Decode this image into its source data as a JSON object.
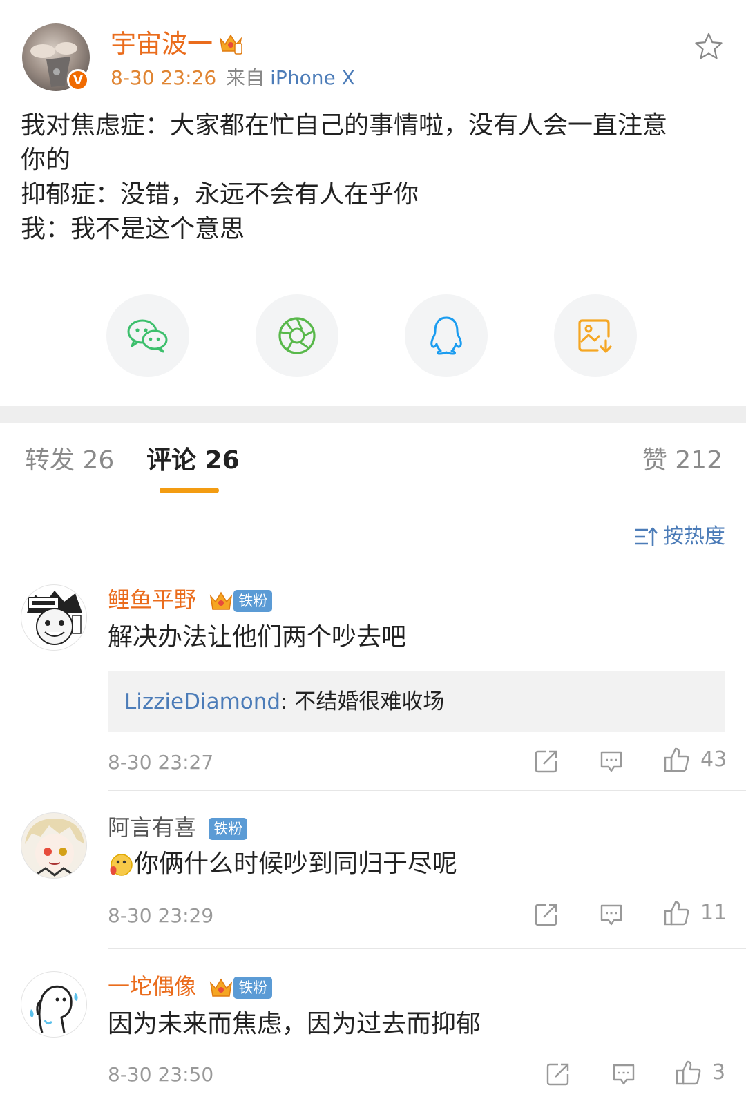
{
  "post": {
    "author": "宇宙波一",
    "verified_mark": "V",
    "time": "8-30 23:26",
    "source_prefix": "来自",
    "source_device": "iPhone X",
    "lines": [
      "我对焦虑症：大家都在忙自己的事情啦，没有人会一直注意",
      "你的",
      "抑郁症：没错，永远不会有人在乎你",
      "我：我不是这个意思"
    ]
  },
  "share": {
    "icons": [
      "wechat-icon",
      "moments-icon",
      "qq-icon",
      "save-image-icon"
    ],
    "colors": {
      "wechat": "#3cbf6c",
      "moments": "#58b84a",
      "qq": "#1a9cf0",
      "save": "#f5a623"
    }
  },
  "tabs": {
    "repost": "转发 26",
    "comments": "评论 26",
    "likes": "赞 212"
  },
  "sort_label": "按热度",
  "comments": [
    {
      "name": "鲤鱼平野",
      "badge": "铁粉",
      "text": "解决办法让他们两个吵去吧",
      "reply": {
        "user": "LizzieDiamond",
        "colon": ": ",
        "text": "不结婚很难收场"
      },
      "time": "8-30 23:27",
      "likes": "43",
      "name_color": "#ea6c1c"
    },
    {
      "name": "阿言有喜",
      "badge": "铁粉",
      "text": "你俩什么时候吵到同归于尽呢",
      "time": "8-30 23:29",
      "likes": "11",
      "name_color": "#555555"
    },
    {
      "name": "一坨偶像",
      "badge": "铁粉",
      "text": "因为未来而焦虑，因为过去而抑郁",
      "time": "8-30 23:50",
      "likes": "3",
      "name_color": "#ea6c1c"
    }
  ],
  "colors": {
    "accent_orange": "#f39c12",
    "link_blue": "#4c7cb8",
    "badge_blue": "#5b9bd5"
  }
}
